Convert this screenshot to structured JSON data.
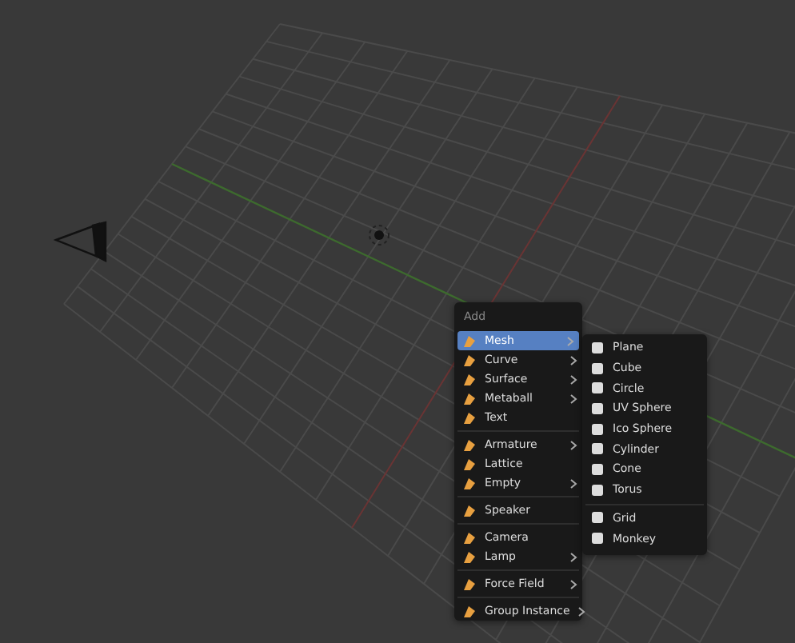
{
  "add_menu": {
    "title": "Add",
    "groups": [
      [
        {
          "label": "Mesh",
          "submenu": true,
          "selected": true
        },
        {
          "label": "Curve",
          "submenu": true,
          "selected": false
        },
        {
          "label": "Surface",
          "submenu": true,
          "selected": false
        },
        {
          "label": "Metaball",
          "submenu": true,
          "selected": false
        },
        {
          "label": "Text",
          "submenu": false,
          "selected": false
        }
      ],
      [
        {
          "label": "Armature",
          "submenu": true,
          "selected": false
        },
        {
          "label": "Lattice",
          "submenu": false,
          "selected": false
        },
        {
          "label": "Empty",
          "submenu": true,
          "selected": false
        }
      ],
      [
        {
          "label": "Speaker",
          "submenu": false,
          "selected": false
        }
      ],
      [
        {
          "label": "Camera",
          "submenu": false,
          "selected": false
        },
        {
          "label": "Lamp",
          "submenu": true,
          "selected": false
        }
      ],
      [
        {
          "label": "Force Field",
          "submenu": true,
          "selected": false
        }
      ],
      [
        {
          "label": "Group Instance",
          "submenu": true,
          "selected": false
        }
      ]
    ]
  },
  "mesh_submenu": {
    "groups": [
      [
        {
          "label": "Plane"
        },
        {
          "label": "Cube"
        },
        {
          "label": "Circle"
        },
        {
          "label": "UV Sphere"
        },
        {
          "label": "Ico Sphere"
        },
        {
          "label": "Cylinder"
        },
        {
          "label": "Cone"
        },
        {
          "label": "Torus"
        }
      ],
      [
        {
          "label": "Grid"
        },
        {
          "label": "Monkey"
        }
      ]
    ]
  }
}
